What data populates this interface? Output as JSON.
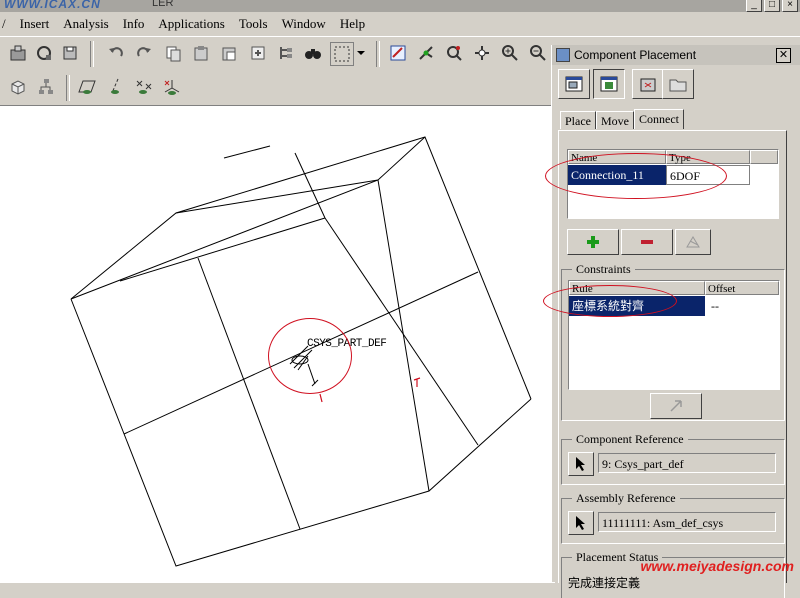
{
  "window": {
    "watermark": "WWW.ICAX.CN",
    "title_fragment": "LER"
  },
  "menu": [
    "Insert",
    "Analysis",
    "Info",
    "Applications",
    "Tools",
    "Window",
    "Help"
  ],
  "viewport": {
    "csys_label": "CSYS_PART_DEF"
  },
  "dialog": {
    "title": "Component Placement",
    "tabs": [
      "Place",
      "Move",
      "Connect"
    ],
    "active_tab": "Connect",
    "connections": {
      "headers": [
        "Name",
        "Type"
      ],
      "rows": [
        {
          "name": "Connection_11",
          "type": "6DOF"
        }
      ]
    },
    "constraints": {
      "label": "Constraints",
      "headers": [
        "Rule",
        "Offset"
      ],
      "rows": [
        {
          "rule": "座標系統對齊",
          "offset": "--"
        }
      ]
    },
    "component_reference": {
      "label": "Component Reference",
      "value": "9: Csys_part_def"
    },
    "assembly_reference": {
      "label": "Assembly Reference",
      "value": "11111111: Asm_def_csys"
    },
    "placement_status": {
      "label": "Placement Status",
      "value": "完成連接定義"
    }
  },
  "footer_watermark": "www.meiyadesign.com",
  "colors": {
    "selection": "#0a246a",
    "highlight_ellipse": "#d01020",
    "add_icon": "#1a9a1a",
    "remove_icon": "#c02030"
  }
}
